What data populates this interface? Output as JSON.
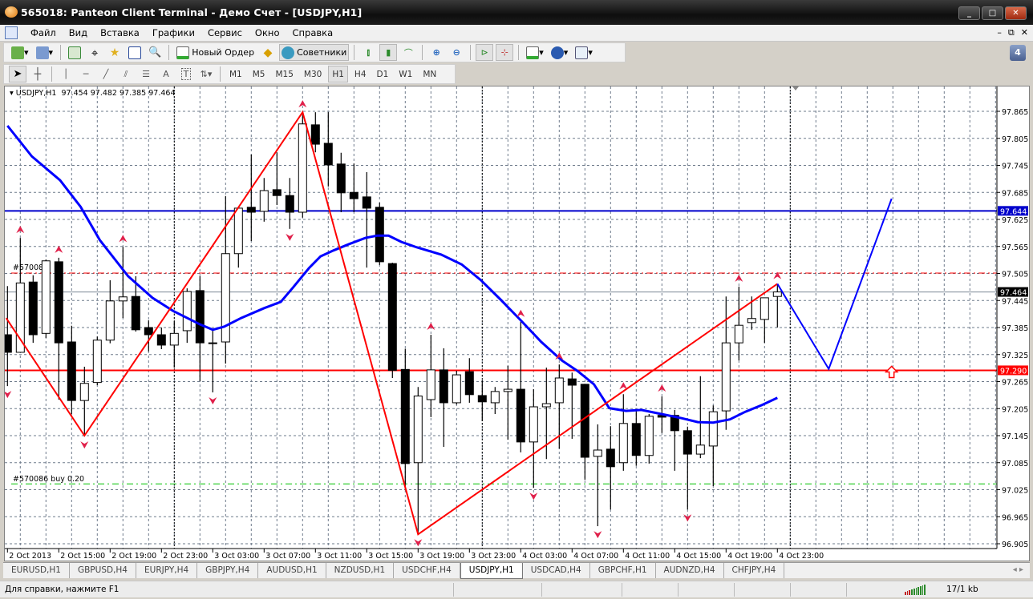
{
  "window": {
    "title": "565018: Panteon Client Terminal - Демо Счет - [USDJPY,H1]",
    "min": "_",
    "max": "□",
    "close": "✕"
  },
  "menu": {
    "items": [
      "Файл",
      "Вид",
      "Вставка",
      "Графики",
      "Сервис",
      "Окно",
      "Справка"
    ],
    "mdi": [
      "–",
      "⧉",
      "✕"
    ]
  },
  "toolbar": {
    "new_order": "Новый Ордер",
    "experts": "Советники",
    "notifications": "4"
  },
  "timeframes": [
    "M1",
    "M5",
    "M15",
    "M30",
    "H1",
    "H4",
    "D1",
    "W1",
    "MN"
  ],
  "active_timeframe": "H1",
  "chart": {
    "legend": "USDJPY,H1  97.454 97.482 97.385 97.464",
    "order_tp_label": "#570086",
    "order_label": "#570086 buy 0.20"
  },
  "chart_data": {
    "type": "candlestick",
    "symbol": "USDJPY",
    "timeframe": "H1",
    "ylim": [
      96.88,
      97.92
    ],
    "yticks": [
      "97.865",
      "97.805",
      "97.745",
      "97.685",
      "97.625",
      "97.565",
      "97.505",
      "97.445",
      "97.385",
      "97.325",
      "97.265",
      "97.205",
      "97.145",
      "97.085",
      "97.025",
      "96.965",
      "96.905"
    ],
    "xticks": [
      {
        "bar": 0,
        "label": "2 Oct 2013"
      },
      {
        "bar": 4,
        "label": "2 Oct 15:00"
      },
      {
        "bar": 8,
        "label": "2 Oct 19:00"
      },
      {
        "bar": 12,
        "label": "2 Oct 23:00"
      },
      {
        "bar": 16,
        "label": "3 Oct 03:00"
      },
      {
        "bar": 20,
        "label": "3 Oct 07:00"
      },
      {
        "bar": 24,
        "label": "3 Oct 11:00"
      },
      {
        "bar": 28,
        "label": "3 Oct 15:00"
      },
      {
        "bar": 32,
        "label": "3 Oct 19:00"
      },
      {
        "bar": 36,
        "label": "3 Oct 23:00"
      },
      {
        "bar": 40,
        "label": "4 Oct 03:00"
      },
      {
        "bar": 44,
        "label": "4 Oct 07:00"
      },
      {
        "bar": 48,
        "label": "4 Oct 11:00"
      },
      {
        "bar": 52,
        "label": "4 Oct 15:00"
      },
      {
        "bar": 56,
        "label": "4 Oct 19:00"
      },
      {
        "bar": 60,
        "label": "4 Oct 23:00"
      }
    ],
    "day_separators": [
      13,
      37,
      61
    ],
    "ohlc": [
      [
        97.369,
        97.477,
        97.255,
        97.33
      ],
      [
        97.33,
        97.584,
        97.33,
        97.484
      ],
      [
        97.486,
        97.501,
        97.351,
        97.369
      ],
      [
        97.372,
        97.536,
        97.362,
        97.533
      ],
      [
        97.531,
        97.54,
        97.225,
        97.351
      ],
      [
        97.353,
        97.389,
        97.193,
        97.223
      ],
      [
        97.223,
        97.298,
        97.143,
        97.261
      ],
      [
        97.263,
        97.365,
        97.257,
        97.357
      ],
      [
        97.357,
        97.49,
        97.35,
        97.444
      ],
      [
        97.444,
        97.564,
        97.406,
        97.453
      ],
      [
        97.454,
        97.499,
        97.376,
        97.38
      ],
      [
        97.385,
        97.401,
        97.332,
        97.369
      ],
      [
        97.369,
        97.385,
        97.337,
        97.346
      ],
      [
        97.346,
        97.399,
        97.296,
        97.372
      ],
      [
        97.378,
        97.472,
        97.351,
        97.465
      ],
      [
        97.467,
        97.499,
        97.266,
        97.351
      ],
      [
        97.351,
        97.378,
        97.241,
        97.351
      ],
      [
        97.353,
        97.677,
        97.305,
        97.549
      ],
      [
        97.549,
        97.65,
        97.518,
        97.65
      ],
      [
        97.652,
        97.769,
        97.577,
        97.641
      ],
      [
        97.643,
        97.717,
        97.62,
        97.689
      ],
      [
        97.691,
        97.774,
        97.657,
        97.678
      ],
      [
        97.678,
        97.717,
        97.604,
        97.641
      ],
      [
        97.641,
        97.863,
        97.629,
        97.837
      ],
      [
        97.835,
        97.863,
        97.774,
        97.792
      ],
      [
        97.794,
        97.863,
        97.698,
        97.746
      ],
      [
        97.748,
        97.773,
        97.641,
        97.684
      ],
      [
        97.685,
        97.749,
        97.641,
        97.671
      ],
      [
        97.675,
        97.73,
        97.518,
        97.65
      ],
      [
        97.652,
        97.662,
        97.524,
        97.531
      ],
      [
        97.527,
        97.529,
        97.273,
        97.29
      ],
      [
        97.292,
        97.338,
        97.025,
        97.083
      ],
      [
        97.085,
        97.253,
        96.926,
        97.233
      ],
      [
        97.225,
        97.369,
        97.186,
        97.291
      ],
      [
        97.291,
        97.339,
        97.12,
        97.218
      ],
      [
        97.218,
        97.289,
        97.214,
        97.28
      ],
      [
        97.287,
        97.317,
        97.218,
        97.236
      ],
      [
        97.234,
        97.268,
        97.177,
        97.22
      ],
      [
        97.218,
        97.253,
        97.193,
        97.243
      ],
      [
        97.243,
        97.3,
        97.136,
        97.248
      ],
      [
        97.248,
        97.398,
        97.108,
        97.131
      ],
      [
        97.131,
        97.248,
        97.029,
        97.209
      ],
      [
        97.209,
        97.296,
        97.093,
        97.216
      ],
      [
        97.218,
        97.303,
        97.116,
        97.273
      ],
      [
        97.271,
        97.285,
        97.138,
        97.257
      ],
      [
        97.259,
        97.26,
        97.047,
        97.097
      ],
      [
        97.099,
        97.17,
        96.944,
        97.113
      ],
      [
        97.115,
        97.166,
        96.981,
        97.076
      ],
      [
        97.085,
        97.237,
        97.067,
        97.172
      ],
      [
        97.172,
        97.204,
        97.078,
        97.101
      ],
      [
        97.101,
        97.193,
        97.083,
        97.188
      ],
      [
        97.19,
        97.232,
        97.151,
        97.186
      ],
      [
        97.19,
        97.202,
        97.067,
        97.156
      ],
      [
        97.156,
        97.165,
        96.981,
        97.104
      ],
      [
        97.104,
        97.277,
        97.095,
        97.124
      ],
      [
        97.122,
        97.212,
        97.033,
        97.198
      ],
      [
        97.2,
        97.454,
        97.158,
        97.351
      ],
      [
        97.351,
        97.476,
        97.312,
        97.39
      ],
      [
        97.396,
        97.454,
        97.38,
        97.405
      ],
      [
        97.403,
        97.451,
        97.351,
        97.451
      ],
      [
        97.454,
        97.482,
        97.385,
        97.464
      ]
    ],
    "moving_average": [
      [
        0,
        97.833
      ],
      [
        1.9,
        97.765
      ],
      [
        4.1,
        97.712
      ],
      [
        5.7,
        97.653
      ],
      [
        7.2,
        97.579
      ],
      [
        9.4,
        97.499
      ],
      [
        11.3,
        97.451
      ],
      [
        12.9,
        97.422
      ],
      [
        15,
        97.392
      ],
      [
        16,
        97.38
      ],
      [
        16.9,
        97.387
      ],
      [
        18.2,
        97.406
      ],
      [
        20,
        97.428
      ],
      [
        21.3,
        97.442
      ],
      [
        22.2,
        97.472
      ],
      [
        23.5,
        97.517
      ],
      [
        24.4,
        97.543
      ],
      [
        25.4,
        97.556
      ],
      [
        26.6,
        97.57
      ],
      [
        27.9,
        97.584
      ],
      [
        28.8,
        97.589
      ],
      [
        29.7,
        97.589
      ],
      [
        30.7,
        97.575
      ],
      [
        31.9,
        97.563
      ],
      [
        33.8,
        97.547
      ],
      [
        35.4,
        97.525
      ],
      [
        36.9,
        97.49
      ],
      [
        38.5,
        97.445
      ],
      [
        40,
        97.401
      ],
      [
        41.6,
        97.353
      ],
      [
        43.2,
        97.312
      ],
      [
        44.4,
        97.289
      ],
      [
        45.7,
        97.259
      ],
      [
        46.9,
        97.206
      ],
      [
        48.2,
        97.2
      ],
      [
        49.4,
        97.202
      ],
      [
        51.3,
        97.191
      ],
      [
        52.5,
        97.184
      ],
      [
        53.8,
        97.175
      ],
      [
        55,
        97.174
      ],
      [
        56.3,
        97.181
      ],
      [
        57.5,
        97.198
      ],
      [
        58.8,
        97.213
      ],
      [
        60,
        97.229
      ]
    ],
    "zigzag": [
      [
        -0.1,
        97.406
      ],
      [
        6,
        97.145
      ],
      [
        23,
        97.863
      ],
      [
        32,
        96.926
      ],
      [
        60,
        97.482
      ]
    ],
    "projection": [
      [
        60,
        97.482
      ],
      [
        64,
        97.293
      ],
      [
        68.9,
        97.671
      ]
    ],
    "buy_arrow": {
      "bar": 68.9,
      "price": 97.29
    },
    "fractals_up": [
      1,
      4,
      9,
      23,
      33,
      40,
      43,
      48,
      51,
      57,
      60
    ],
    "fractals_down": [
      0,
      6,
      16,
      22,
      32,
      41,
      46,
      53
    ],
    "hlines": {
      "resistance": {
        "price": 97.644,
        "label": "97.644",
        "color": "#0000cc"
      },
      "support": {
        "price": 97.29,
        "label": "97.290",
        "color": "#ff0000"
      },
      "bid": {
        "price": 97.464,
        "label": "97.464",
        "color": "#000000"
      },
      "order_tp": {
        "price": 97.506,
        "color": "#ff0000"
      },
      "order_open": {
        "price": 97.038,
        "color": "#00c000"
      }
    }
  },
  "tabs": [
    "EURUSD,H1",
    "GBPUSD,H4",
    "EURJPY,H4",
    "GBPJPY,H4",
    "AUDUSD,H1",
    "NZDUSD,H1",
    "USDCHF,H4",
    "USDJPY,H1",
    "USDCAD,H4",
    "GBPCHF,H1",
    "AUDNZD,H4",
    "CHFJPY,H4"
  ],
  "active_tab": "USDJPY,H1",
  "tab_nav": "◂ ▸",
  "status": {
    "help": "Для справки, нажмите F1",
    "traffic": "17/1 kb"
  }
}
